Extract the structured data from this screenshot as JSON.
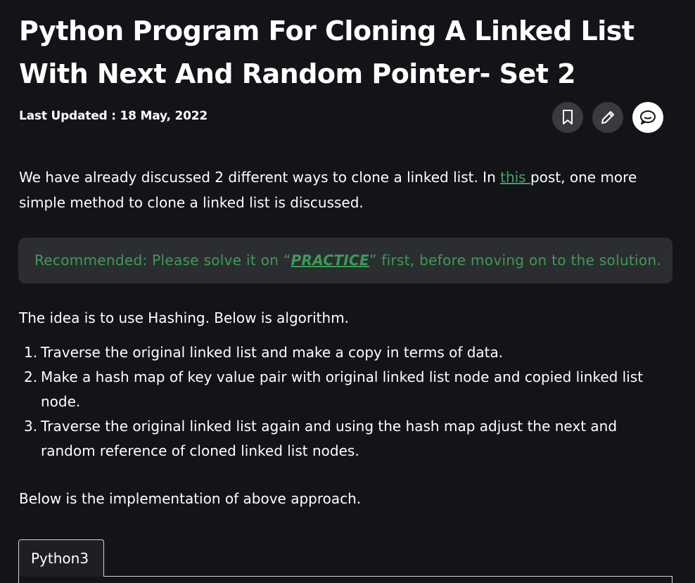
{
  "article": {
    "title": "Python Program For Cloning A Linked List With Next And Random Pointer- Set 2",
    "last_updated": "Last Updated : 18 May, 2022",
    "actions": {
      "bookmark_icon": "bookmark-icon",
      "edit_icon": "pencil-icon",
      "comment_icon": "comment-icon"
    },
    "intro": {
      "before_link": "We have already discussed 2 different ways to clone a linked list. In ",
      "link_text": "this ",
      "after_link": "post, one more simple method to clone a linked list is discussed."
    },
    "recommended": {
      "before": "Recommended: Please solve it on “",
      "link_text": "PRACTICE",
      "after": "” first, before moving on to the solution."
    },
    "idea": "The idea is to use Hashing. Below is algorithm.",
    "steps": [
      {
        "num": "1.",
        "text": "Traverse the original linked list and make a copy in terms of data."
      },
      {
        "num": "2.",
        "text": "Make a hash map of key value pair with original linked list node and copied linked list node."
      },
      {
        "num": "3.",
        "text": "Traverse the original linked list again and using the hash map adjust the next and random reference of cloned linked list nodes."
      }
    ],
    "implementation": "Below is the implementation of above approach.",
    "code_tab": "Python3"
  },
  "colors": {
    "background": "#131417",
    "link": "#3fa66b",
    "recommend_bg": "#2c2d31",
    "recommend_text": "#3a9c55"
  }
}
